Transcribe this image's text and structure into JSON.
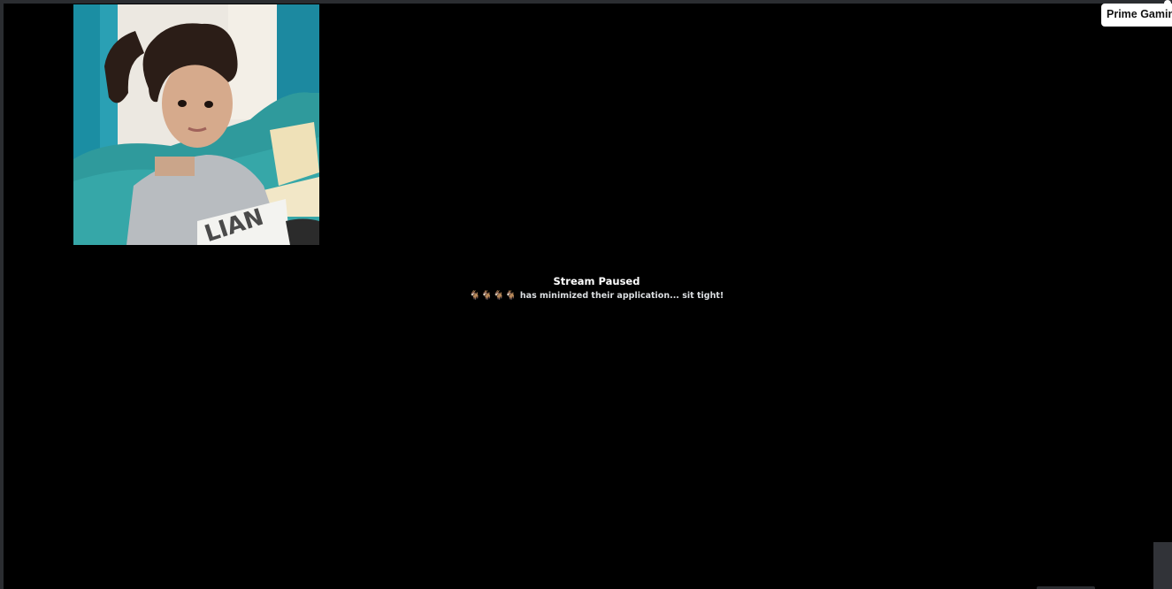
{
  "stream": {
    "title": "Stream Paused",
    "username_icons": [
      "goat",
      "goat",
      "goat",
      "goat"
    ],
    "message": "has minimized their application... sit tight!"
  },
  "tooltip": {
    "label": "Prime Gamin"
  },
  "colors": {
    "background": "#000000",
    "border": "#2b2d31",
    "tooltip_bg": "#ffffff"
  }
}
